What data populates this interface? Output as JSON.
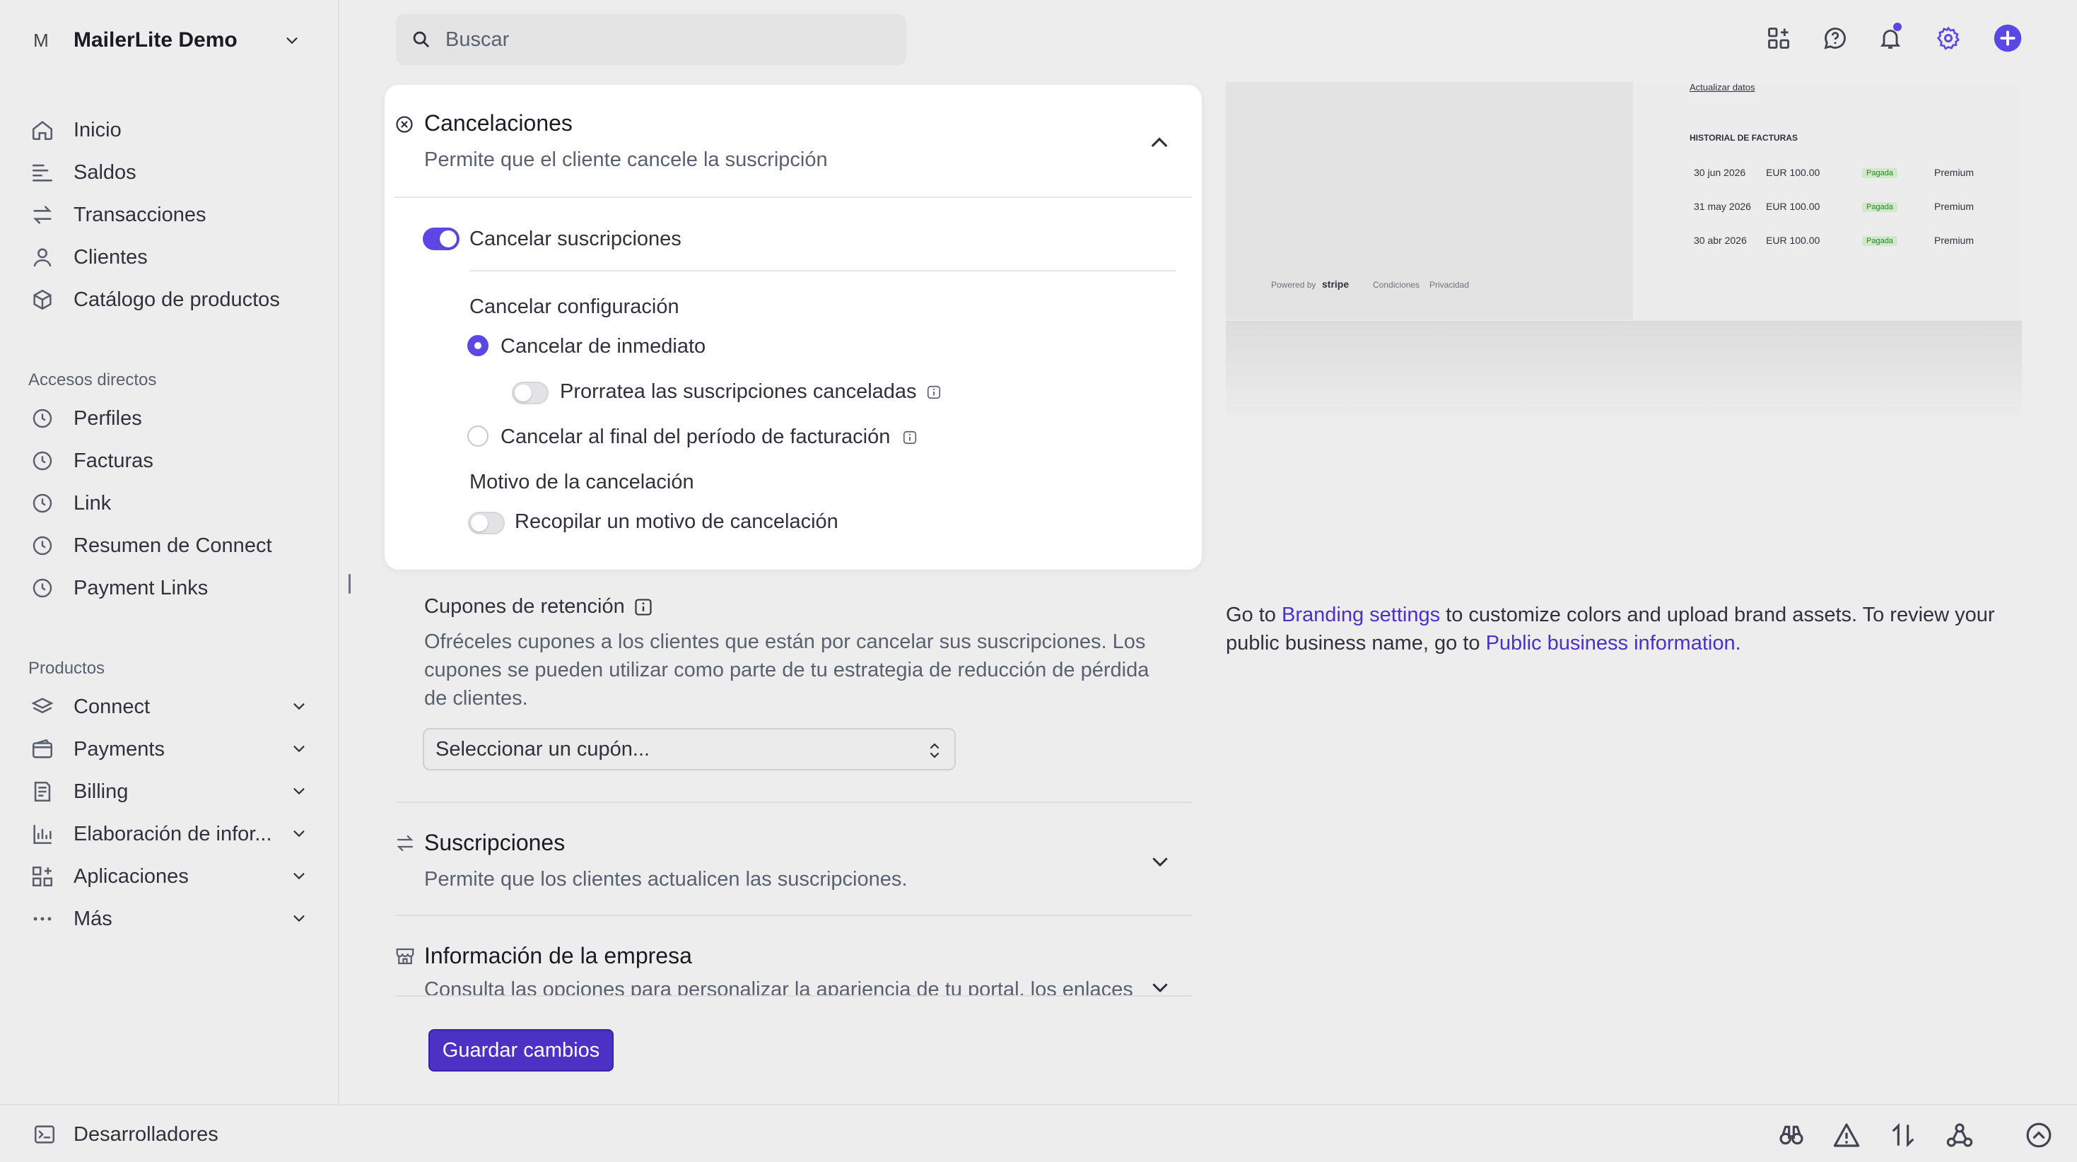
{
  "account": {
    "initial": "M",
    "name": "MailerLite Demo"
  },
  "nav_main": [
    {
      "label": "Inicio",
      "icon": "home-icon"
    },
    {
      "label": "Saldos",
      "icon": "balances-icon"
    },
    {
      "label": "Transacciones",
      "icon": "transactions-icon"
    },
    {
      "label": "Clientes",
      "icon": "customers-icon"
    },
    {
      "label": "Catálogo de productos",
      "icon": "product-catalog-icon"
    }
  ],
  "shortcuts": {
    "heading": "Accesos directos",
    "items": [
      {
        "label": "Perfiles",
        "icon": "clock-icon"
      },
      {
        "label": "Facturas",
        "icon": "clock-icon"
      },
      {
        "label": "Link",
        "icon": "clock-icon"
      },
      {
        "label": "Resumen de Connect",
        "icon": "clock-icon"
      },
      {
        "label": "Payment Links",
        "icon": "clock-icon"
      }
    ]
  },
  "products": {
    "heading": "Productos",
    "items": [
      {
        "label": "Connect",
        "icon": "connect-icon"
      },
      {
        "label": "Payments",
        "icon": "payments-icon"
      },
      {
        "label": "Billing",
        "icon": "billing-icon"
      },
      {
        "label": "Elaboración de infor...",
        "icon": "reporting-icon"
      },
      {
        "label": "Aplicaciones",
        "icon": "apps-icon"
      },
      {
        "label": "Más",
        "icon": "more-icon"
      }
    ]
  },
  "developers": {
    "label": "Desarrolladores"
  },
  "search": {
    "placeholder": "Buscar"
  },
  "card": {
    "title": "Cancelaciones",
    "subtitle": "Permite que el cliente cancele la suscripción",
    "toggle_label": "Cancelar suscripciones",
    "toggle_on": true,
    "config_heading": "Cancelar configuración",
    "opt_immediate": "Cancelar de inmediato",
    "opt_prorate": "Prorratea las suscripciones canceladas",
    "opt_end_period": "Cancelar al final del período de facturación",
    "reason_heading": "Motivo de la cancelación",
    "reason_toggle": "Recopilar un motivo de cancelación"
  },
  "coupons": {
    "title": "Cupones de retención",
    "description": "Ofréceles cupones a los clientes que están por cancelar sus suscripciones. Los cupones se pueden utilizar como parte de tu estrategia de reducción de pérdida de clientes.",
    "select_value": "Seleccionar un cupón..."
  },
  "subscriptions": {
    "title": "Suscripciones",
    "subtitle": "Permite que los clientes actualicen las suscripciones."
  },
  "business_info": {
    "title": "Información de la empresa",
    "subtitle": "Consulta las opciones para personalizar la apariencia de tu portal, los enlaces"
  },
  "save_button": "Guardar cambios",
  "preview": {
    "update_link": "Actualizar datos",
    "history_heading": "HISTORIAL DE FACTURAS",
    "rows": [
      {
        "date": "30 jun 2026",
        "amount": "EUR 100.00",
        "status": "Pagada",
        "plan": "Premium"
      },
      {
        "date": "31 may 2026",
        "amount": "EUR 100.00",
        "status": "Pagada",
        "plan": "Premium"
      },
      {
        "date": "30 abr 2026",
        "amount": "EUR 100.00",
        "status": "Pagada",
        "plan": "Premium"
      }
    ],
    "powered_by": "Powered by",
    "stripe": "stripe",
    "terms": "Condiciones",
    "privacy": "Privacidad"
  },
  "branding": {
    "pre": "Go to ",
    "link1": "Branding settings",
    "mid": " to customize colors and upload brand assets. To review your public business name, go to ",
    "link2": "Public business information."
  },
  "colors": {
    "accent": "#5b48e4",
    "button": "#4b31c4"
  }
}
